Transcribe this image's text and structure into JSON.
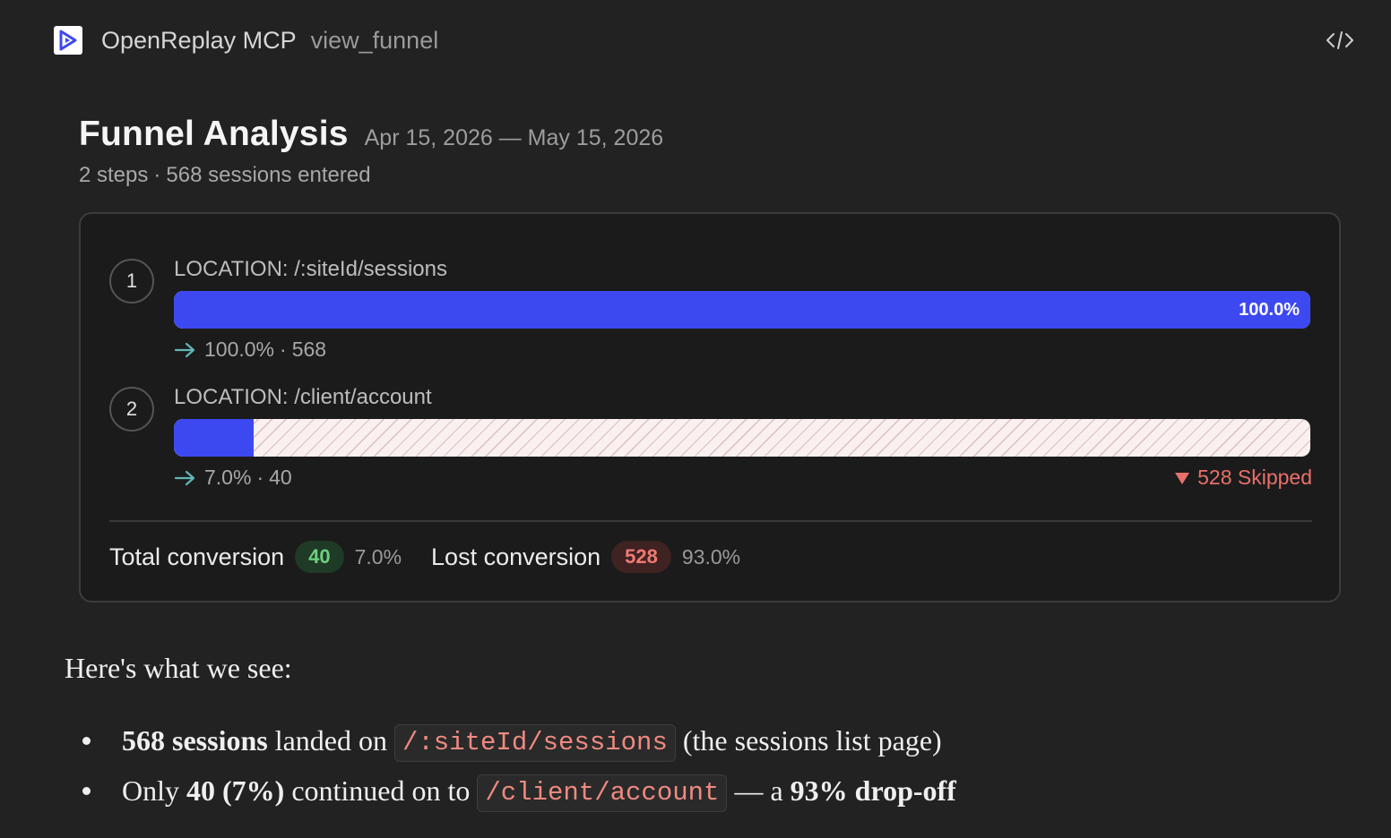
{
  "header": {
    "app_name": "OpenReplay MCP",
    "tool_name": "view_funnel",
    "logo_icon": "openreplay-logo-icon",
    "code_icon": "code-brackets-icon"
  },
  "funnel": {
    "title": "Funnel Analysis",
    "date_range": "Apr 15, 2026 — May 15, 2026",
    "steps_count": "2 steps",
    "sessions_entered": "568 sessions entered",
    "steps": [
      {
        "number": "1",
        "label": "LOCATION: /:siteId/sessions",
        "completion_fraction": 1.0,
        "bar_pct": "100.0%",
        "conv_pct": "100.0%",
        "count": "568"
      },
      {
        "number": "2",
        "label": "LOCATION: /client/account",
        "completion_fraction": 0.07,
        "conv_pct": "7.0%",
        "count": "40",
        "skipped": "528 Skipped"
      }
    ],
    "totals": {
      "total_label": "Total conversion",
      "total_count": "40",
      "total_pct": "7.0%",
      "lost_label": "Lost conversion",
      "lost_count": "528",
      "lost_pct": "93.0%"
    },
    "colors": {
      "bar_fill": "#3d49f0",
      "skipped": "#e9706a",
      "positive": "#6fd07f"
    }
  },
  "summary": {
    "heading": "Here's what we see:",
    "bullet1": {
      "bold": "568 sessions",
      "text1": " landed on ",
      "code": "/:siteId/sessions",
      "text2": " (the sessions list page)"
    },
    "bullet2": {
      "text1": "Only ",
      "bold1": "40 (7%)",
      "text2": " continued on to ",
      "code": "/client/account",
      "text3": " — a ",
      "bold2": "93% drop-off"
    }
  }
}
